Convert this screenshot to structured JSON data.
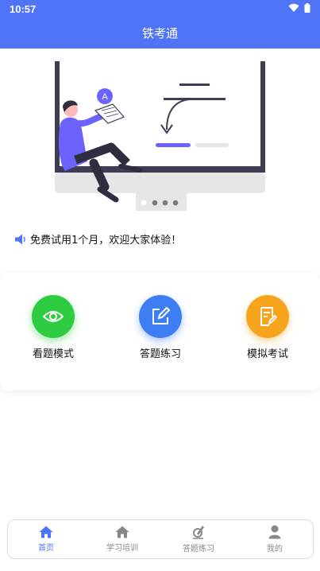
{
  "status_bar": {
    "time": "10:57"
  },
  "header": {
    "title": "铁考通"
  },
  "notice": {
    "text": "免费试用1个月，欢迎大家体验！"
  },
  "features": [
    {
      "label": "看题模式",
      "color": "#2ecc40",
      "icon": "eye-icon"
    },
    {
      "label": "答题练习",
      "color": "#3d7ef5",
      "icon": "edit-icon"
    },
    {
      "label": "模拟考试",
      "color": "#f7a41d",
      "icon": "exam-icon"
    }
  ],
  "tabbar": {
    "items": [
      {
        "label": "首页",
        "icon": "home-icon",
        "active": true
      },
      {
        "label": "学习培训",
        "icon": "home-icon",
        "active": false
      },
      {
        "label": "答题练习",
        "icon": "pen-icon",
        "active": false
      },
      {
        "label": "我的",
        "icon": "person-icon",
        "active": false
      }
    ]
  },
  "colors": {
    "primary": "#4f74f5",
    "accent_banner": "#6c63ff"
  }
}
